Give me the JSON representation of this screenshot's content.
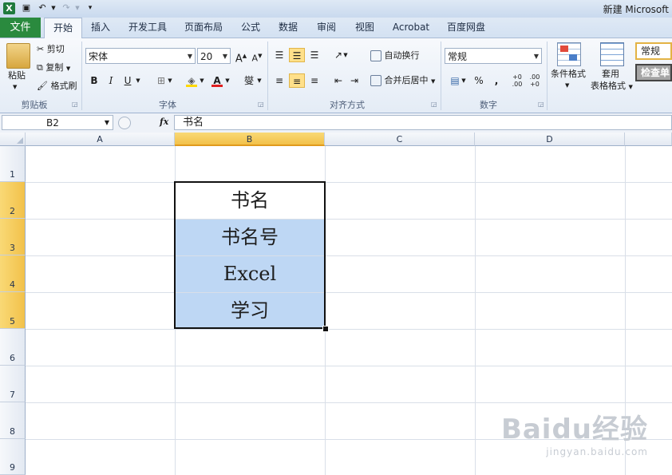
{
  "window": {
    "title": "新建 Microsoft",
    "app_icon": "excel-icon",
    "quick_access": [
      "save-icon",
      "undo-icon",
      "redo-icon",
      "customize-icon"
    ]
  },
  "tabs": {
    "file": "文件",
    "items": [
      "开始",
      "插入",
      "开发工具",
      "页面布局",
      "公式",
      "数据",
      "审阅",
      "视图",
      "Acrobat",
      "百度网盘"
    ],
    "active": "开始"
  },
  "ribbon": {
    "clipboard": {
      "paste": "粘贴",
      "cut": "剪切",
      "copy": "复制",
      "format_painter": "格式刷",
      "label": "剪贴板"
    },
    "font": {
      "name": "宋体",
      "size": "20",
      "grow": "A",
      "shrink": "A",
      "bold": "B",
      "italic": "I",
      "underline": "U",
      "font_color": "A",
      "phonetic": "燮",
      "label": "字体"
    },
    "alignment": {
      "wrap": "自动换行",
      "merge": "合并后居中",
      "label": "对齐方式"
    },
    "number": {
      "format": "常规",
      "percent": "%",
      "comma": ",",
      "inc_dec": ".0\n.00",
      "dec_dec": ".00\n.0",
      "label": "数字"
    },
    "styles": {
      "conditional": "条件格式",
      "table_a": "套用",
      "table_b": "表格格式",
      "normal": "常规",
      "check_cell": "检查单"
    }
  },
  "formula_bar": {
    "name_box": "B2",
    "fx": "fx",
    "content": "书名"
  },
  "grid": {
    "columns": [
      "A",
      "B",
      "C",
      "D"
    ],
    "rows": [
      "1",
      "2",
      "3",
      "4",
      "5",
      "6",
      "7",
      "8",
      "9"
    ],
    "cells": {
      "B2": "书名",
      "B3": "书名号",
      "B4": "Excel",
      "B5": "学习"
    }
  },
  "watermark": {
    "logo": "Baidu经验",
    "url": "jingyan.baidu.com"
  },
  "colors": {
    "file_tab": "#2a8a3e",
    "selection_fill": "#bed7f4",
    "header_selected": "#f2c14a"
  }
}
